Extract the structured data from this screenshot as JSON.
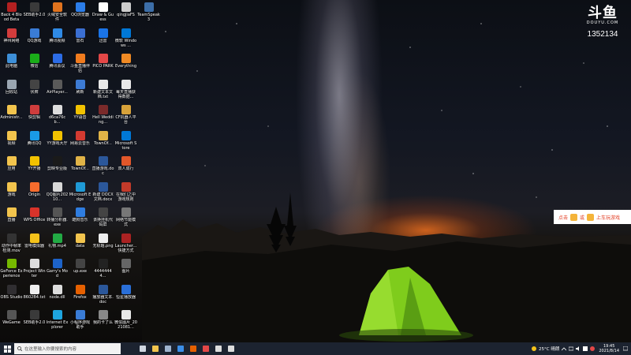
{
  "desktop": {
    "icons": [
      {
        "label": "Back 4 Blood Beta",
        "color": "#b32020"
      },
      {
        "label": "SEB助手2.0",
        "color": "#3a3a3a"
      },
      {
        "label": "火绒安全软件",
        "color": "#e0731e"
      },
      {
        "label": "QQ浏览器",
        "color": "#2b7de8"
      },
      {
        "label": "Draw & Guess",
        "color": "#ffffff"
      },
      {
        "label": "qingjiaFS",
        "color": "#cccccc"
      },
      {
        "label": "TeamSpeak 3",
        "color": "#3c6ea8"
      },
      {
        "label": "神州网络",
        "color": "#d23c3c"
      },
      {
        "label": "QQ游戏",
        "color": "#3a7cd6"
      },
      {
        "label": "腾讯视频",
        "color": "#2f8ae5"
      },
      {
        "label": "雷石",
        "color": "#3b6fd2"
      },
      {
        "label": "迅雷",
        "color": "#1a74e8"
      },
      {
        "label": "微软 Windows ...",
        "color": "#0078d7"
      },
      {
        "label": "此电脑",
        "color": "#3d8fd8"
      },
      {
        "label": "微信",
        "color": "#1aad19"
      },
      {
        "label": "腾讯会议",
        "color": "#2c6ce6"
      },
      {
        "label": "斗鱼直播伴侣",
        "color": "#f07b1e"
      },
      {
        "label": "PICO PARK",
        "color": "#e34747"
      },
      {
        "label": "Everything",
        "color": "#f08a24"
      },
      {
        "label": "回收站",
        "color": "#9aa6b2"
      },
      {
        "label": "伏牌",
        "color": "#444444"
      },
      {
        "label": "AirPlayer...",
        "color": "#5a5a5a"
      },
      {
        "label": "刷新",
        "color": "#3d7bd4"
      },
      {
        "label": "新建文本文档.txt",
        "color": "#e8e8e8"
      },
      {
        "label": "每天直播获得数据...",
        "color": "#e8e8e8"
      },
      {
        "label": "Administr...",
        "color": "#f2c44d"
      },
      {
        "label": "快剪辑",
        "color": "#cf3d3d"
      },
      {
        "label": "d6ca76cb...",
        "color": "#dddddd"
      },
      {
        "label": "YY语音",
        "color": "#f2c200"
      },
      {
        "label": "Hell Wedding...",
        "color": "#7a2a2a"
      },
      {
        "label": "CF机器人平台",
        "color": "#d8a23a"
      },
      {
        "label": "视频",
        "color": "#f2c44d"
      },
      {
        "label": "腾讯QQ",
        "color": "#1a9be6"
      },
      {
        "label": "YY游戏大厅",
        "color": "#f2c200"
      },
      {
        "label": "网易云音乐",
        "color": "#d33a31"
      },
      {
        "label": "TownOf...",
        "color": "#e0b347"
      },
      {
        "label": "Microsoft Store",
        "color": "#0078d7"
      },
      {
        "label": "应用",
        "color": "#f2c44d"
      },
      {
        "label": "YY开播",
        "color": "#f2c200"
      },
      {
        "label": "剪映专业版",
        "color": "#1a1a1a"
      },
      {
        "label": "TownOf...",
        "color": "#e0b347"
      },
      {
        "label": "直播游戏.doc",
        "color": "#2b579a"
      },
      {
        "label": "双人成行",
        "color": "#e2572a"
      },
      {
        "label": "游戏",
        "color": "#f2c44d"
      },
      {
        "label": "Origin",
        "color": "#f56c2d"
      },
      {
        "label": "QQ图片20210...",
        "color": "#d8d8d8"
      },
      {
        "label": "Microsoft Edge",
        "color": "#1f9ad6"
      },
      {
        "label": "新建 DOCX 文档.docx",
        "color": "#2b579a"
      },
      {
        "label": "在我们之中游戏规则",
        "color": "#c23a2a"
      },
      {
        "label": "直播",
        "color": "#f2c44d"
      },
      {
        "label": "WPS Office",
        "color": "#d9332a"
      },
      {
        "label": "转播分析器.exe",
        "color": "#555555"
      },
      {
        "label": "酷狗音乐",
        "color": "#2f7de0"
      },
      {
        "label": "该换挂机代码屏",
        "color": "#444444"
      },
      {
        "label": "网络节能模式",
        "color": "#777777"
      },
      {
        "label": "动作中帧率检测.mov",
        "color": "#333333"
      },
      {
        "label": "雷电模拟器",
        "color": "#f4c21a"
      },
      {
        "label": "礼物.mp4",
        "color": "#22aa44"
      },
      {
        "label": "data",
        "color": "#f2c44d"
      },
      {
        "label": "无标题.png",
        "color": "#eeeeee"
      },
      {
        "label": "Launcher... 快捷方式",
        "color": "#aa2222"
      },
      {
        "label": "GeForce Experience",
        "color": "#76b900"
      },
      {
        "label": "Project Winter",
        "color": "#dddddd"
      },
      {
        "label": "Garry's Mod",
        "color": "#1d63c9"
      },
      {
        "label": "up.exe",
        "color": "#444444"
      },
      {
        "label": "44444444...",
        "color": "#222222"
      },
      {
        "label": "图片",
        "color": "#666666"
      },
      {
        "label": "OBS Studio",
        "color": "#302e31"
      },
      {
        "label": "8602B4.txt",
        "color": "#eeeeee"
      },
      {
        "label": "node.dll",
        "color": "#dddddd"
      },
      {
        "label": "Firefox",
        "color": "#e66000"
      },
      {
        "label": "播放器文本.doc",
        "color": "#2b579a"
      },
      {
        "label": "恒星播放器",
        "color": "#2a6fd8"
      },
      {
        "label": "WeGame",
        "color": "#555555"
      },
      {
        "label": "SEB助手2.0",
        "color": "#3a3a3a"
      },
      {
        "label": "Internet Explorer",
        "color": "#1ea5e0"
      },
      {
        "label": "小程序游戏助手",
        "color": "#3a7cd6"
      },
      {
        "label": "我的卡了么",
        "color": "#888888"
      },
      {
        "label": "微信图片_2021081...",
        "color": "#e8e8e8"
      }
    ]
  },
  "watermark": {
    "logo": "斗鱼",
    "site": "DOUYU.COM",
    "room_id": "1352134"
  },
  "promo": {
    "text_left": "点击",
    "text_mid": "或",
    "text_right": "上车玩游戏"
  },
  "taskbar": {
    "search_placeholder": "在这里输入你要搜索的内容",
    "apps": [
      {
        "name": "task-view-icon",
        "color": "#cfd6e0"
      },
      {
        "name": "file-explorer-icon",
        "color": "#f2c44d"
      },
      {
        "name": "steam-icon",
        "color": "#9fb4cf"
      },
      {
        "name": "app-icon",
        "color": "#3b8ee8"
      },
      {
        "name": "firefox-icon",
        "color": "#e66000"
      },
      {
        "name": "media-icon",
        "color": "#e34747"
      },
      {
        "name": "obs-icon",
        "color": "#dddddd"
      },
      {
        "name": "plane-icon",
        "color": "#dddddd"
      }
    ],
    "weather": "25°C 晴朗",
    "time": "19:45",
    "date": "2021/8/14"
  }
}
